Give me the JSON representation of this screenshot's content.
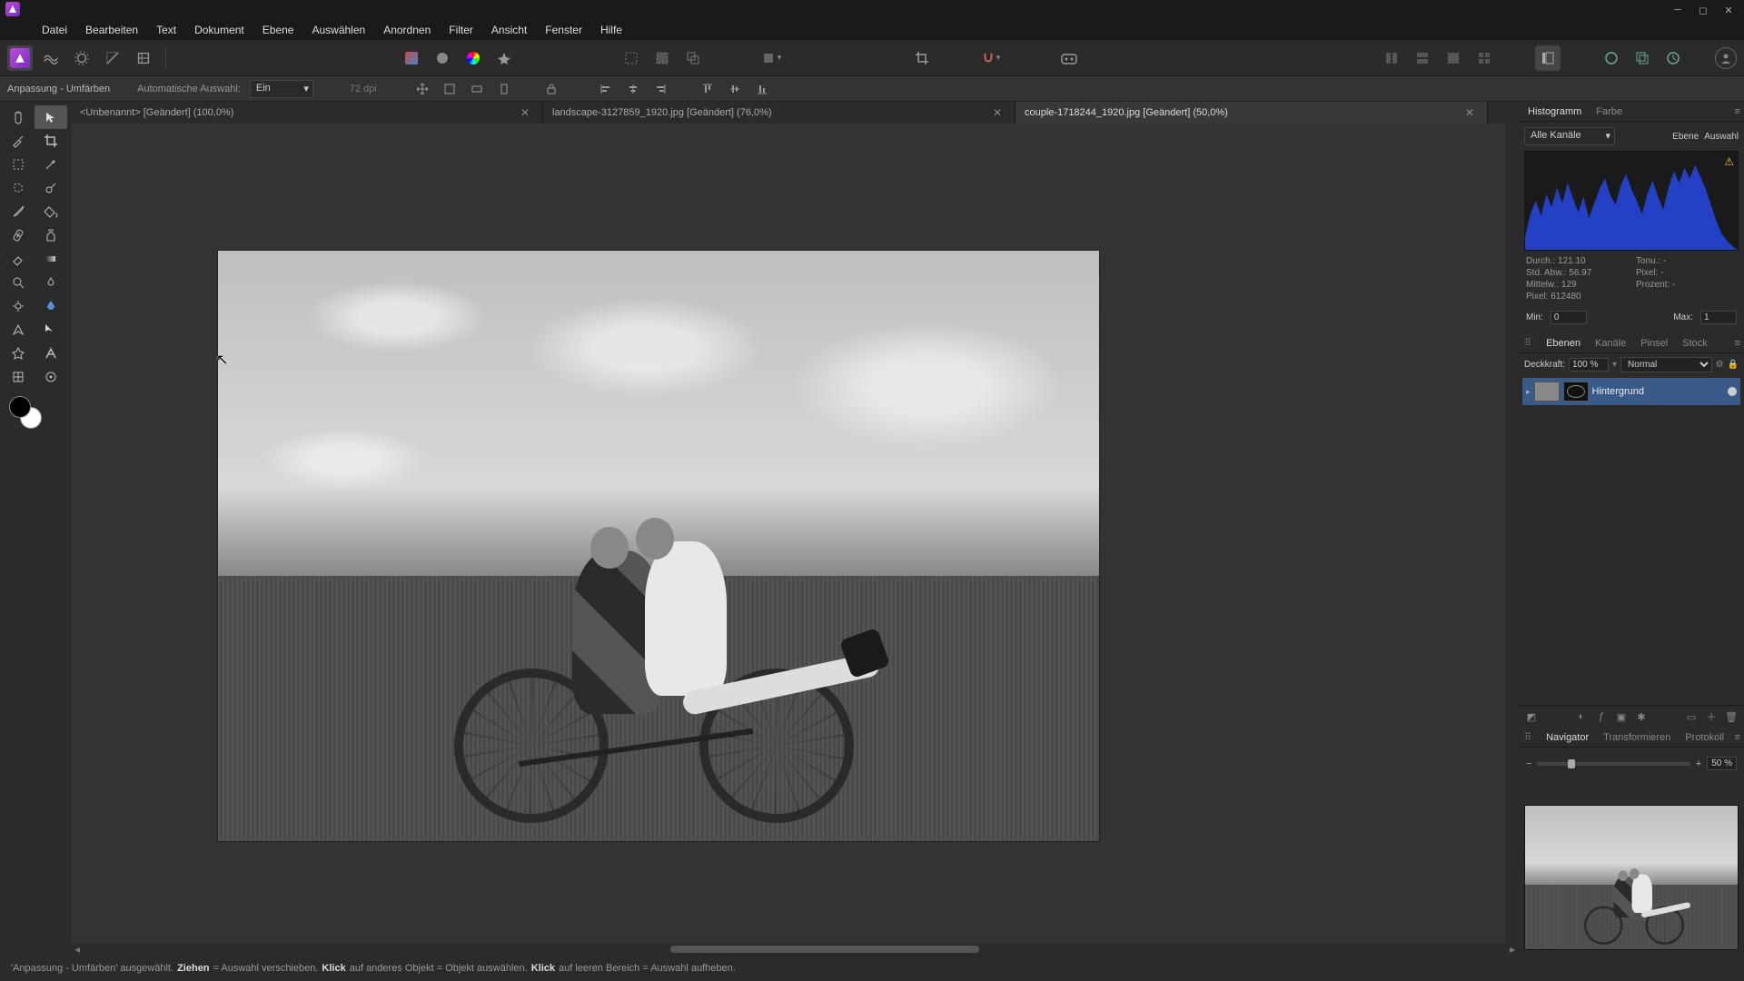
{
  "window": {
    "title": "Affinity Photo"
  },
  "menu": [
    "Datei",
    "Bearbeiten",
    "Text",
    "Dokument",
    "Ebene",
    "Auswählen",
    "Anordnen",
    "Filter",
    "Ansicht",
    "Fenster",
    "Hilfe"
  ],
  "contextbar": {
    "tool_label": "Anpassung - Umfärben",
    "auto_label": "Automatische Auswahl:",
    "auto_value": "Ein",
    "dpi": "72 dpi"
  },
  "tabs": [
    {
      "label": "<Unbenannt> [Geändert] (100,0%)",
      "active": false
    },
    {
      "label": "landscape-3127859_1920.jpg [Geändert] (76,0%)",
      "active": false
    },
    {
      "label": "couple-1718244_1920.jpg [Geändert] (50,0%)",
      "active": true
    }
  ],
  "histogram": {
    "tabs": [
      "Histogramm",
      "Farbe"
    ],
    "active_tab": "Histogramm",
    "channel": "Alle Kanäle",
    "btn_ebene": "Ebene",
    "btn_auswahl": "Auswahl",
    "stats": {
      "durch": "Durch.: 121.10",
      "std": "Std. Abw.: 56.97",
      "mittel": "Mittelw.: 129",
      "pixel": "Pixel: 612480",
      "tonu": "Tonu.: -",
      "pixel2": "Pixel: -",
      "prozent": "Prozent: -"
    },
    "min_label": "Min:",
    "min_value": "0",
    "max_label": "Max:",
    "max_value": "1"
  },
  "layers": {
    "tabs": [
      "Ebenen",
      "Kanäle",
      "Pinsel",
      "Stock"
    ],
    "active_tab": "Ebenen",
    "opacity_label": "Deckkraft:",
    "opacity_value": "100 %",
    "blend_mode": "Normal",
    "layer_name": "Hintergrund"
  },
  "navigator": {
    "tabs": [
      "Navigator",
      "Transformieren",
      "Protokoll"
    ],
    "active_tab": "Navigator",
    "zoom": "50 %"
  },
  "status": {
    "pre": "'Anpassung - Umfärben' ausgewählt. ",
    "b1": "Ziehen",
    "t1": " = Auswahl verschieben. ",
    "b2": "Klick",
    "t2": " auf anderes Objekt = Objekt auswählen. ",
    "b3": "Klick",
    "t3": " auf leeren Bereich = Auswahl aufheben."
  }
}
